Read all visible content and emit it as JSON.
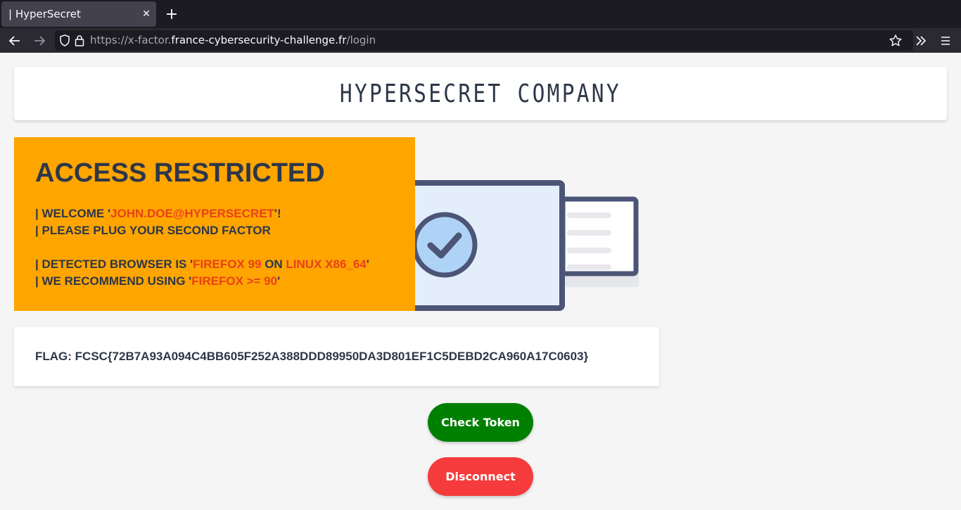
{
  "browser": {
    "tab_title": "| HyperSecret",
    "url_prefix": "https://x-factor.",
    "url_domain": "france-cybersecurity-challenge.fr",
    "url_path": "/login"
  },
  "header": {
    "company_name": "HYPERSECRET COMPANY"
  },
  "alert": {
    "title": "ACCESS RESTRICTED",
    "welcome_prefix": "| WELCOME '",
    "user": "JOHN.DOE@HYPERSECRET",
    "welcome_suffix": "'!",
    "plug_line": "| PLEASE PLUG YOUR SECOND FACTOR",
    "browser_prefix": "| DETECTED BROWSER IS '",
    "browser_name": "FIREFOX 99",
    "browser_on": " ON ",
    "browser_os": "LINUX X86_64",
    "browser_suffix": "'",
    "recommend_prefix": "| WE RECOMMEND USING '",
    "recommend_value": "FIREFOX >= 90",
    "recommend_suffix": "'"
  },
  "flag": {
    "text": "FLAG: FCSC{72B7A93A094C4BB605F252A388DDD89950DA3D801EF1C5DEBD2CA960A17C0603}"
  },
  "buttons": {
    "check_token": "Check Token",
    "disconnect": "Disconnect"
  },
  "colors": {
    "alert_bg": "#ffa500",
    "highlight": "#e84118",
    "check_btn": "#008000",
    "disconnect_btn": "#f53b3b"
  }
}
